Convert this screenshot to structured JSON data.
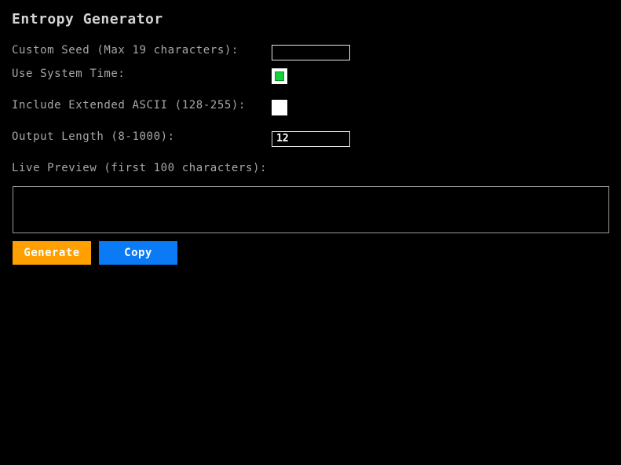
{
  "app": {
    "title": "Entropy Generator"
  },
  "form": {
    "custom_seed": {
      "label": "Custom Seed (Max 19 characters):",
      "value": ""
    },
    "use_system_time": {
      "label": "Use System Time:",
      "checked": true
    },
    "include_extended_ascii": {
      "label": "Include Extended ASCII (128-255):",
      "checked": false
    },
    "output_length": {
      "label": "Output Length (8-1000):",
      "value": "12"
    }
  },
  "preview": {
    "label": "Live Preview (first 100 characters):",
    "content": ""
  },
  "buttons": {
    "generate": "Generate",
    "copy": "Copy"
  },
  "colors": {
    "background": "#000000",
    "generate_button": "#ffa000",
    "copy_button": "#0a7af5",
    "checkbox_checked": "#19d13a"
  }
}
